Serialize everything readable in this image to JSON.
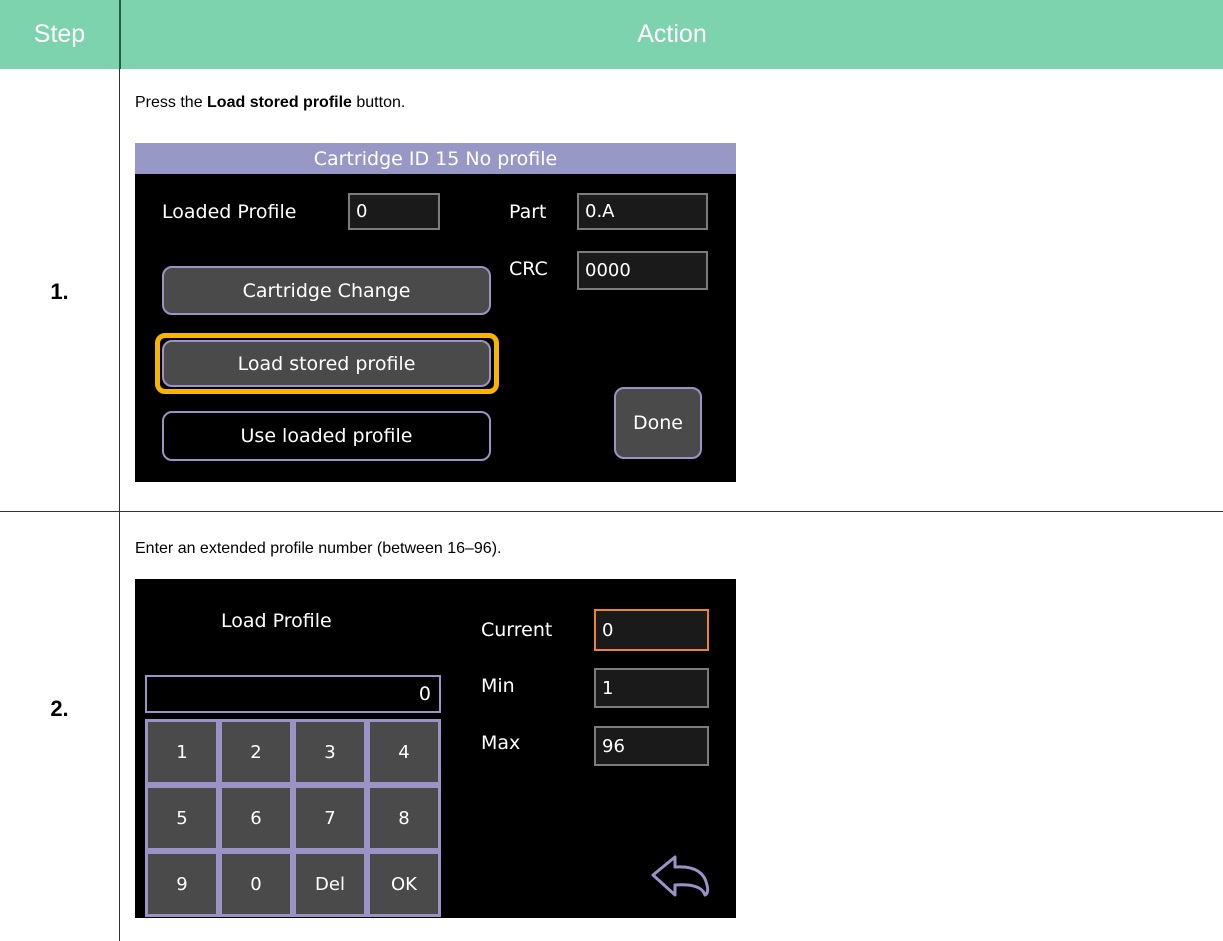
{
  "table": {
    "header_step": "Step",
    "header_action": "Action"
  },
  "rows": [
    {
      "step": "1.",
      "instruction_prefix": "Press the ",
      "instruction_bold": "Load stored profile",
      "instruction_suffix": " button.",
      "screen": {
        "title": "Cartridge ID 15 No profile",
        "loaded_profile_label": "Loaded Profile",
        "loaded_profile_value": "0",
        "part_label": "Part",
        "part_value": "0.A",
        "crc_label": "CRC",
        "crc_value": "0000",
        "cartridge_change": "Cartridge Change",
        "load_stored_profile": "Load stored profile",
        "use_loaded_profile": "Use loaded profile",
        "done": "Done",
        "highlight_color": "#f7b500"
      }
    },
    {
      "step": "2.",
      "instruction": "Enter an extended profile number (between 16–96).",
      "screen": {
        "title": "Load Profile",
        "display_value": "0",
        "current_label": "Current",
        "current_value": "0",
        "min_label": "Min",
        "min_value": "1",
        "max_label": "Max",
        "max_value": "96",
        "keys": [
          "1",
          "2",
          "3",
          "4",
          "5",
          "6",
          "7",
          "8",
          "9",
          "0",
          "Del",
          "OK"
        ],
        "back_icon": "back-arrow-icon"
      }
    }
  ],
  "colors": {
    "header_bg": "#7dd3ae",
    "button_border": "#9b93c6",
    "title_bar": "#9898c6",
    "current_field_border": "#e8833a"
  }
}
